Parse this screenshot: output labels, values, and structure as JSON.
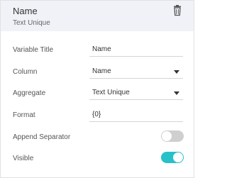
{
  "header": {
    "title": "Name",
    "subtitle": "Text Unique",
    "delete_icon": "trash-icon"
  },
  "form": {
    "variable_title": {
      "label": "Variable Title",
      "value": "Name"
    },
    "column": {
      "label": "Column",
      "value": "Name"
    },
    "aggregate": {
      "label": "Aggregate",
      "value": "Text Unique"
    },
    "format": {
      "label": "Format",
      "value": "{0}"
    },
    "append_separator": {
      "label": "Append Separator",
      "checked": false
    },
    "visible": {
      "label": "Visible",
      "checked": true
    }
  },
  "colors": {
    "toggle_on": "#26c1c9",
    "toggle_off": "#cfcfcf",
    "header_bg": "#f1f2f7"
  }
}
